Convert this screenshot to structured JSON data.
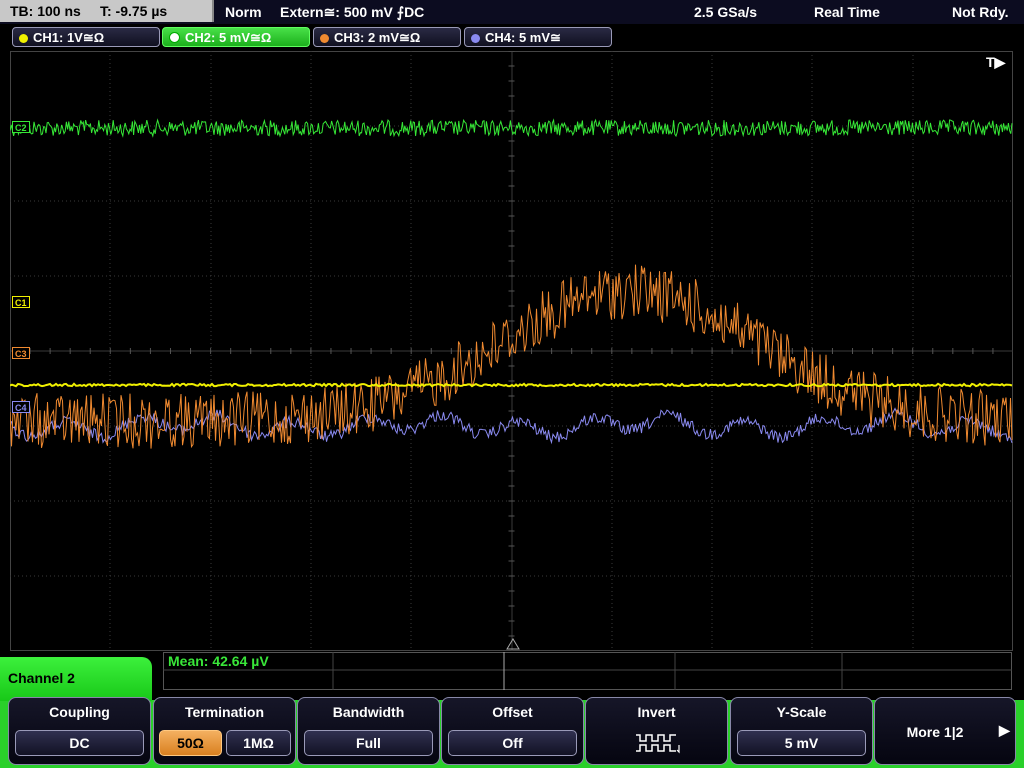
{
  "status_bar": {
    "timebase": "TB: 100 ns",
    "trigger_time": "T: -9.75 µs",
    "trigger_mode": "Norm",
    "trigger_source": "Extern≅: 500 mV ⨍DC",
    "sample_rate": "2.5 GSa/s",
    "acquisition_mode": "Real Time",
    "run_state": "Not Rdy."
  },
  "channels": [
    {
      "label": "CH1: 1V≅Ω",
      "color": "#f0f000"
    },
    {
      "label": "CH2: 5 mV≅Ω",
      "color": "#36e836"
    },
    {
      "label": "CH3: 2 mV≅Ω",
      "color": "#f08a30"
    },
    {
      "label": "CH4: 5 mV≅",
      "color": "#8a8af0"
    }
  ],
  "trigger_marker": "T▶",
  "markers": {
    "c1": "C1",
    "c2": "C2",
    "c3": "C3",
    "c4": "C4"
  },
  "measurement": {
    "mean": "Mean: 42.64 µV"
  },
  "menu": {
    "channel": "Channel 2",
    "coupling": {
      "title": "Coupling",
      "value": "DC"
    },
    "termination": {
      "title": "Termination",
      "opt1": "50Ω",
      "opt2": "1MΩ"
    },
    "bandwidth": {
      "title": "Bandwidth",
      "value": "Full"
    },
    "offset": {
      "title": "Offset",
      "value": "Off"
    },
    "invert": {
      "title": "Invert"
    },
    "yscale": {
      "title": "Y-Scale",
      "value": "5 mV"
    },
    "more": {
      "label": "More 1|2"
    }
  }
}
